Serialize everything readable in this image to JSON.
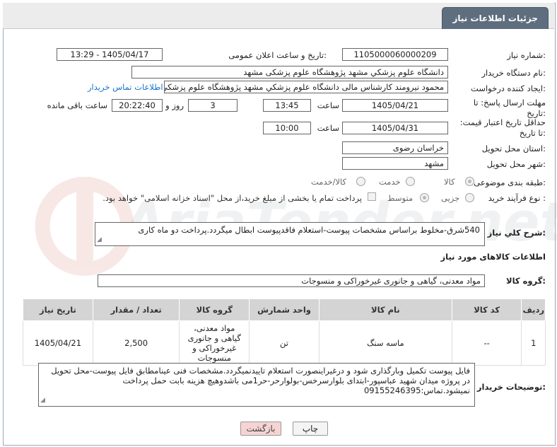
{
  "header": {
    "title": "جزئیات اطلاعات نیاز"
  },
  "labels": {
    "need_number": "شماره نیاز:",
    "announce_datetime": "تاریخ و ساعت اعلان عمومی:",
    "buyer_org": "نام دستگاه خریدار:",
    "requester": "ایجاد کننده درخواست:",
    "reply_deadline": "مهلت ارسال پاسخ: تا تاریخ:",
    "price_validity": "حداقل تاریخ اعتبار قیمت: تا تاریخ:",
    "time": "ساعت",
    "day_and": "روز و",
    "remaining": "ساعت باقی مانده",
    "province": "استان محل تحویل:",
    "city": "شهر محل تحویل:",
    "category": "طبقه بندی موضوعی:",
    "purchase_type": "نوع فرآیند خرید :",
    "general_desc": "شرح كلي نياز:",
    "goods_info": "اطلاعات کالاهای مورد نیاز",
    "goods_group": "گروه کالا:",
    "buyer_notes": "توضیحات خریدار:"
  },
  "fields": {
    "need_number": "1105000060000209",
    "announce_datetime": "1405/04/17 - 13:29",
    "buyer_org": "دانشگاه علوم پزشكي مشهد   پژوهشگاه علوم پزشکی مشهد",
    "requester": "محمود نیرومند کارشناس مالی دانشگاه علوم پزشكي مشهد   پژوهشگاه علوم پزشکی مشهد",
    "contact_link": "اطلاعات تماس خریدار",
    "reply_date": "1405/04/21",
    "reply_time": "13:45",
    "reply_days": "3",
    "reply_remaining": "20:22:40",
    "validity_date": "1405/04/31",
    "validity_time": "10:00",
    "province": "خراسان رضوی",
    "city": "مشهد",
    "general_desc": "540شرق-مخلوط براساس مشخصات پیوست-استعلام فاقدپیوست ابطال میگردد.پرداخت دو ماه کاری",
    "goods_group": "مواد معدنی، گیاهی و جانوری غیرخوراکی و منسوجات",
    "buyer_notes": "فایل پیوست تکمیل وبارگذاری شود و درغیراینصورت استعلام تاییدنمیگردد.مشخصات فنی عینامطابق فایل پیوست-محل تحویل در پروژه میدان شهید عباسپور-ابتدای بلوارسرخس-بولوارحر-حر1می باشدوهیچ هزینه بابت حمل  پرداخت نمیشود.تماس:09155246395"
  },
  "category_options": [
    "کالا",
    "خدمت",
    "کالا/خدمت"
  ],
  "category_selected": "کالا",
  "purchase_options": [
    "جزیی",
    "متوسط"
  ],
  "purchase_selected": "متوسط",
  "payment_note": "پرداخت تمام یا بخشی از مبلغ خرید،از محل \"اسناد خزانه اسلامی\" خواهد بود.",
  "table": {
    "headers": [
      "ردیف",
      "کد کالا",
      "نام کالا",
      "واحد شمارش",
      "گروه کالا",
      "تعداد / مقدار",
      "تاریخ نیاز"
    ],
    "rows": [
      {
        "row": "1",
        "code": "--",
        "name": "ماسه سنگ",
        "unit": "تن",
        "group": "مواد معدنی، گیاهی و جانوری غیرخوراکی و منسوجات",
        "qty": "2,500",
        "date": "1405/04/21"
      }
    ]
  },
  "buttons": {
    "back": "بازگشت",
    "print": "چاپ"
  },
  "watermark_text": "AriaTender.net",
  "colors": {
    "header_tab": "#5e6e7f",
    "link": "#1a73c8",
    "table_head": "#d4d4d4"
  }
}
